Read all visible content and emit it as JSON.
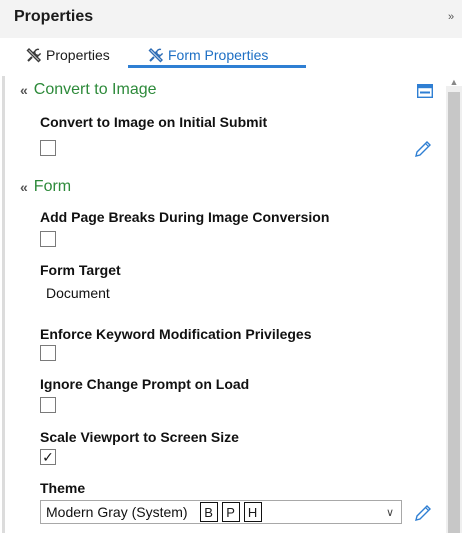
{
  "panel": {
    "title": "Properties",
    "collapse_glyph": "»"
  },
  "tabs": [
    {
      "label": "Properties",
      "icon": "tools-icon",
      "active": false
    },
    {
      "label": "Form Properties",
      "icon": "form-tools-icon",
      "active": true
    }
  ],
  "sections": {
    "convert": {
      "chevron": "«",
      "title": "Convert to Image",
      "props": {
        "convert_initial_submit": {
          "label": "Convert to Image on Initial Submit",
          "checked": false
        }
      }
    },
    "form": {
      "chevron": "«",
      "title": "Form",
      "props": {
        "add_page_breaks": {
          "label": "Add Page Breaks During Image Conversion",
          "checked": false
        },
        "form_target": {
          "label": "Form Target",
          "value": "Document"
        },
        "enforce_keyword": {
          "label": "Enforce Keyword Modification Privileges",
          "checked": false
        },
        "ignore_change_prompt": {
          "label": "Ignore Change Prompt on Load",
          "checked": false
        },
        "scale_viewport": {
          "label": "Scale Viewport to Screen Size",
          "checked": true,
          "check_glyph": "✓"
        },
        "theme": {
          "label": "Theme",
          "selected": "Modern Gray (System)",
          "buttons": [
            "B",
            "P",
            "H"
          ],
          "arrow": "∨"
        }
      }
    }
  },
  "colors": {
    "section_title": "#2d8a3a",
    "accent": "#2f7fd3",
    "header_bg": "#f3f3f3"
  }
}
